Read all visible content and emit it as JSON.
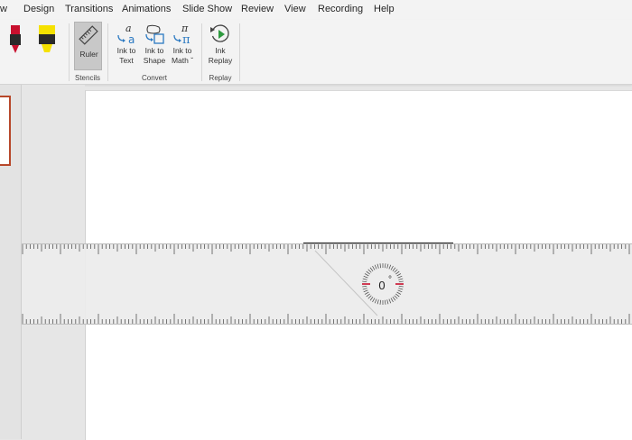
{
  "menu": {
    "tabs": [
      "w",
      "Design",
      "Transitions",
      "Animations",
      "Slide Show",
      "Review",
      "View",
      "Recording",
      "Help"
    ]
  },
  "ribbon": {
    "stencils": {
      "ruler_label": "Ruler",
      "group_label": "Stencils"
    },
    "convert": {
      "ink_to_text": [
        "Ink to",
        "Text"
      ],
      "ink_to_shape": [
        "Ink to",
        "Shape"
      ],
      "ink_to_math": [
        "Ink to",
        "Math ˇ"
      ],
      "group_label": "Convert"
    },
    "replay": {
      "ink_replay": [
        "Ink",
        "Replay"
      ],
      "group_label": "Replay"
    }
  },
  "ruler": {
    "angle": "0"
  },
  "colors": {
    "red_pen": "#c8102e",
    "yellow_highlighter": "#f5e100",
    "thumb_border": "#b7472a",
    "ruler_fill": "#ececec",
    "accent_blue": "#2b79c2",
    "replay_green": "#2e9a3f"
  },
  "icons": {
    "pen": "red-pen-icon",
    "highlighter": "yellow-highlighter-icon",
    "ruler": "ruler-icon",
    "ink_to_text": "ink-to-text-icon",
    "ink_to_shape": "ink-to-shape-icon",
    "ink_to_math": "ink-to-math-icon",
    "ink_replay": "ink-replay-icon"
  }
}
